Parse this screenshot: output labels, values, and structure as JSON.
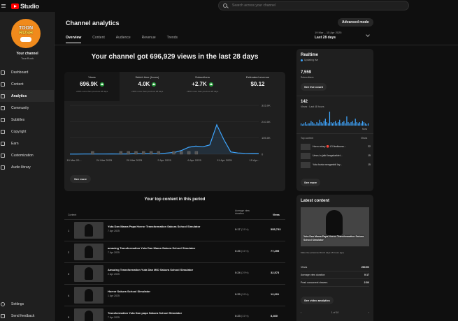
{
  "app": {
    "logo_text": "Studio"
  },
  "search": {
    "placeholder": "Search across your channel"
  },
  "channel": {
    "avatar_line1": "TOON",
    "avatar_line2": "RUSH",
    "name": "Your channel",
    "handle": "ToonRush"
  },
  "sidebar": {
    "items": [
      {
        "label": "Dashboard",
        "icon": "dashboard-icon"
      },
      {
        "label": "Content",
        "icon": "content-icon"
      },
      {
        "label": "Analytics",
        "icon": "analytics-icon"
      },
      {
        "label": "Community",
        "icon": "community-icon"
      },
      {
        "label": "Subtitles",
        "icon": "subtitles-icon"
      },
      {
        "label": "Copyright",
        "icon": "copyright-icon"
      },
      {
        "label": "Earn",
        "icon": "earn-icon"
      },
      {
        "label": "Customization",
        "icon": "customization-icon"
      },
      {
        "label": "Audio library",
        "icon": "audio-library-icon"
      }
    ],
    "bottom": [
      {
        "label": "Settings",
        "icon": "settings-icon"
      },
      {
        "label": "Send feedback",
        "icon": "feedback-icon"
      }
    ]
  },
  "header": {
    "title": "Channel analytics",
    "advanced_mode": "Advanced mode",
    "tabs": [
      "Overview",
      "Content",
      "Audience",
      "Revenue",
      "Trends"
    ],
    "date_range_sub": "19 Mar – 15 Apr 2025",
    "date_range_main": "Last 28 days"
  },
  "overview": {
    "headline": "Your channel got 696,929 views in the last 28 days",
    "metrics": [
      {
        "label": "Views",
        "value": "696.9K",
        "note": "+99% more than previous 28 days"
      },
      {
        "label": "Watch time (hours)",
        "value": "4.0K",
        "note": "+99% more than previous 28 days"
      },
      {
        "label": "Subscribers",
        "value": "+2.7K",
        "note": "+99% more than previous 28 days"
      },
      {
        "label": "Estimated revenue",
        "value": "$0.12",
        "note": ""
      }
    ],
    "see_more": "See more"
  },
  "chart_data": {
    "type": "line",
    "title": "",
    "x_labels": [
      "19 Mar 20...",
      "24 Mar 2025",
      "29 Mar 2025",
      "2 Apr 2025",
      "6 Apr 2025",
      "11 Apr 2025",
      "15 Apr..."
    ],
    "y_ticks": [
      "315.0K",
      "210.0K",
      "105.0K",
      "0"
    ],
    "ylim": [
      0,
      315000
    ],
    "values": [
      1000,
      900,
      1200,
      1500,
      1300,
      1400,
      1600,
      1500,
      2000,
      2500,
      3000,
      2800,
      3500,
      4000,
      8000,
      12000,
      25000,
      45000,
      52000,
      48000,
      60000,
      190000,
      95000,
      15000,
      8000,
      6000,
      5000,
      4500
    ],
    "color": "#3ea6ff"
  },
  "top_content": {
    "title": "Your top content in this period",
    "col_content": "Content",
    "col_duration": "Average view duration",
    "col_views": "Views",
    "rows": [
      {
        "num": "1",
        "title": "Yuta Dan Mama Papa Horror Transformation Sakura School Simulator",
        "date": "7 Apr 2025",
        "duration": "0:17",
        "pct": "(31%)",
        "views": "555,733"
      },
      {
        "num": "2",
        "title": "amazing Transformation Yuta Dan Mama Sakura School Simulator",
        "date": "7 Apr 2025",
        "duration": "0:25",
        "pct": "(31%)",
        "views": "77,295"
      },
      {
        "num": "3",
        "title": "Amazing Transformation Yuta Dan MIO Sakura School Simulator",
        "date": "2 Apr 2025",
        "duration": "0:24",
        "pct": "(29%)",
        "views": "32,573"
      },
      {
        "num": "4",
        "title": "Horror Sakura School Simulator",
        "date": "1 Apr 2025",
        "duration": "0:29",
        "pct": "(26%)",
        "views": "12,001"
      },
      {
        "num": "5",
        "title": "Transformation Yuta Dan papa Sakura School Simulator",
        "date": "7 Apr 2025",
        "duration": "0:23",
        "pct": "(31%)",
        "views": "8,460"
      }
    ]
  },
  "realtime": {
    "title": "Realtime",
    "live": "Updating live",
    "subs": "7,559",
    "subs_label": "Subscribers",
    "see_live": "See live count",
    "views": "142",
    "views_label": "Views · Last 48 hours",
    "now_label": "Now",
    "top_label": "Top content",
    "top_views_label": "Views",
    "bars": [
      2,
      1,
      2,
      3,
      1,
      2,
      2,
      4,
      3,
      2,
      1,
      3,
      2,
      5,
      3,
      2,
      4,
      6,
      3,
      2,
      12,
      3,
      2,
      3,
      4,
      2,
      3,
      5,
      2,
      3,
      4,
      2,
      8,
      3,
      2,
      3,
      4,
      2,
      6,
      3,
      2,
      3,
      2,
      4,
      3,
      2,
      1,
      2
    ],
    "top": [
      {
        "title": "Horror story 🔴 L3 Ikwikouss...",
        "views": "22"
      },
      {
        "title": "Umm.i.s.jatki langskarklet...",
        "views": "15"
      },
      {
        "title": "Yuta horta mengambil lay...",
        "views": "15"
      }
    ],
    "see_more": "See more"
  },
  "latest": {
    "title": "Latest content",
    "video_title": "Yuta Dan Mama Papa Horror Transformation Sakura School Simulator",
    "note": "Make live (streamed first 3 days 15 hours ago)",
    "stats": [
      {
        "label": "Views",
        "value": "260.9K"
      },
      {
        "label": "Average view duration",
        "value": "0:17"
      },
      {
        "label": "Peak concurrent viewers",
        "value": "2.3K"
      }
    ],
    "see_analytics": "See video analytics",
    "pager": "1 of 10"
  }
}
